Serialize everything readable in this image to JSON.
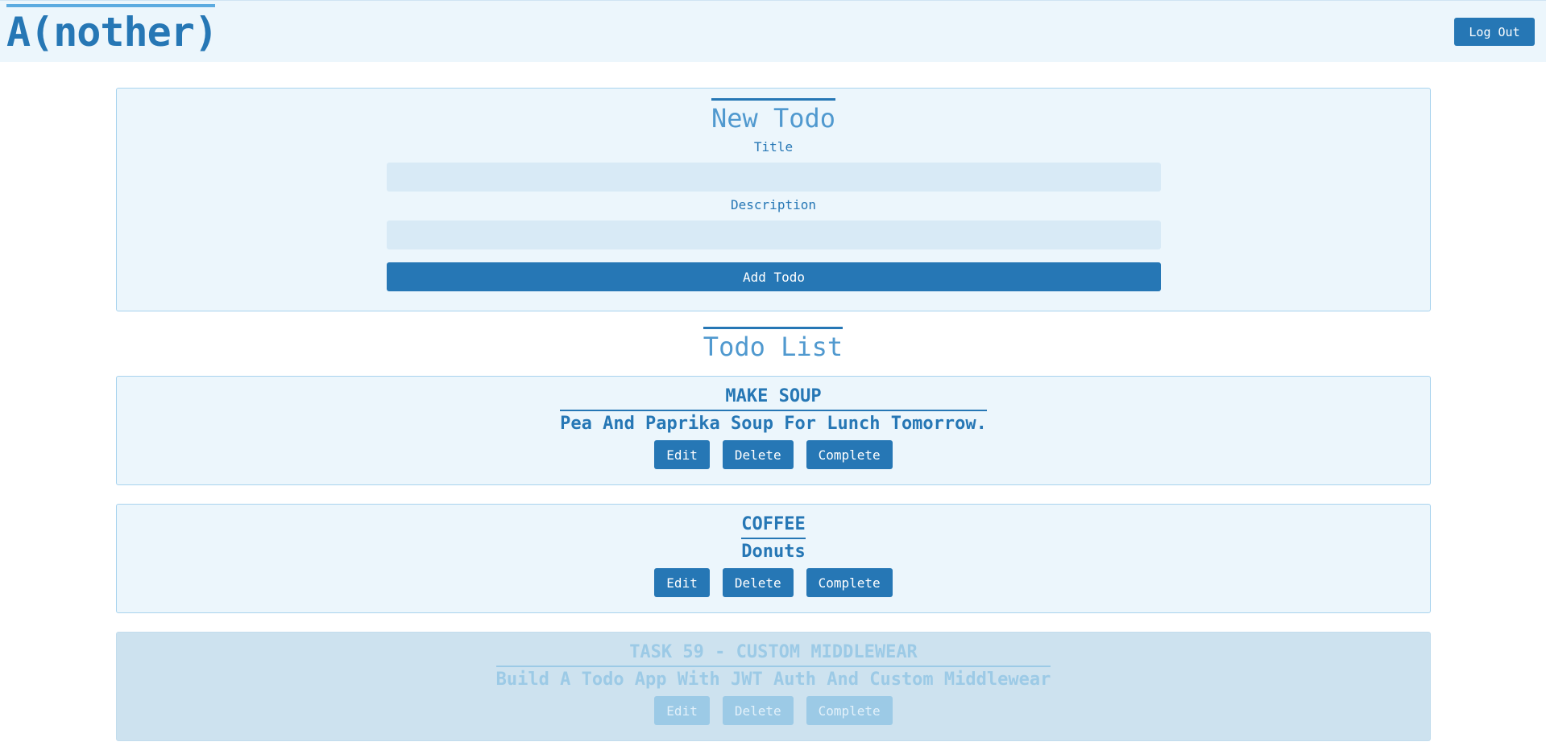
{
  "header": {
    "brand": "A(nother)",
    "logout_label": "Log Out"
  },
  "new_todo": {
    "heading": "New Todo",
    "title_label": "Title",
    "title_value": "",
    "description_label": "Description",
    "description_value": "",
    "submit_label": "Add Todo"
  },
  "todo_list": {
    "heading": "Todo List",
    "items": [
      {
        "title": "Make Soup",
        "description": "Pea And Paprika Soup For Lunch Tomorrow.",
        "edit_label": "Edit",
        "delete_label": "Delete",
        "complete_label": "Complete",
        "completed": false
      },
      {
        "title": "Coffee",
        "description": "Donuts",
        "edit_label": "Edit",
        "delete_label": "Delete",
        "complete_label": "Complete",
        "completed": false
      },
      {
        "title": "Task 59 - Custom Middlewear",
        "description": "Build A Todo App With JWT Auth And Custom Middlewear",
        "edit_label": "Edit",
        "delete_label": "Delete",
        "complete_label": "Complete",
        "completed": true
      }
    ]
  },
  "colors": {
    "primary": "#2677b5",
    "panel_bg": "#ecf6fc",
    "input_bg": "#d8eaf6",
    "completed_bg": "#cde2ef",
    "completed_text": "#9ccae6"
  }
}
